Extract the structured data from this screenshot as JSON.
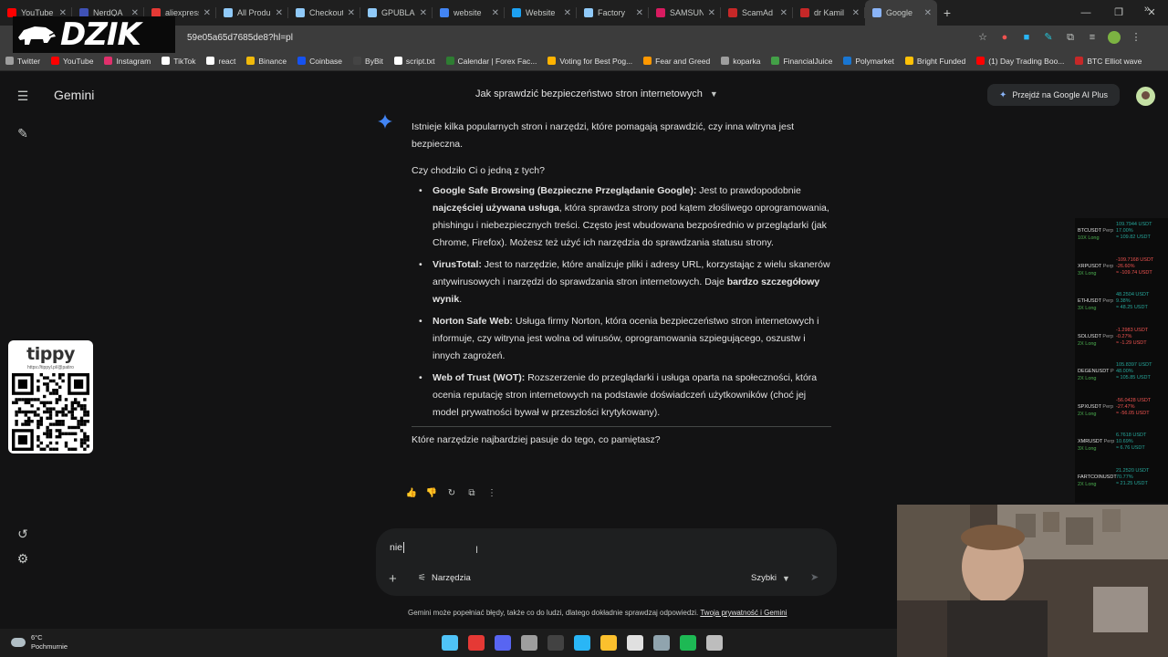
{
  "browser": {
    "tabs": [
      {
        "label": "YouTube",
        "color": "#ff0000",
        "active": false
      },
      {
        "label": "NerdQA",
        "color": "#3f51b5",
        "active": false
      },
      {
        "label": "aliexpress",
        "color": "#e53935",
        "active": false
      },
      {
        "label": "All Produ",
        "color": "#90caf9",
        "active": false
      },
      {
        "label": "Checkout",
        "color": "#90caf9",
        "active": false
      },
      {
        "label": "GPUBLA",
        "color": "#90caf9",
        "active": false
      },
      {
        "label": "website",
        "color": "#4285f4",
        "active": false
      },
      {
        "label": "Website",
        "color": "#1da1f2",
        "active": false
      },
      {
        "label": "Factory",
        "color": "#90caf9",
        "active": false
      },
      {
        "label": "SAMSUN",
        "color": "#d81b60",
        "active": false
      },
      {
        "label": "ScamAd",
        "color": "#c62828",
        "active": false
      },
      {
        "label": "dr Kamil",
        "color": "#c62828",
        "active": false
      },
      {
        "label": "Google",
        "color": "#8ab4f8",
        "active": true
      }
    ],
    "url": "59e05a65d7685de8?hl=pl",
    "bookmarks": [
      {
        "label": "Twitter",
        "color": "#9e9e9e"
      },
      {
        "label": "YouTube",
        "color": "#ff0000"
      },
      {
        "label": "Instagram",
        "color": "#e1306c"
      },
      {
        "label": "TikTok",
        "color": "#ffffff"
      },
      {
        "label": "react",
        "color": "#ffffff"
      },
      {
        "label": "Binance",
        "color": "#f0b90b"
      },
      {
        "label": "Coinbase",
        "color": "#1652f0"
      },
      {
        "label": "ByBit",
        "color": "#444444"
      },
      {
        "label": "script.txt",
        "color": "#ffffff"
      },
      {
        "label": "Calendar | Forex Fac...",
        "color": "#2e7d32"
      },
      {
        "label": "Voting for Best Pog...",
        "color": "#ffb300"
      },
      {
        "label": "Fear and Greed",
        "color": "#ff9800"
      },
      {
        "label": "koparka",
        "color": "#9e9e9e"
      },
      {
        "label": "FinancialJuice",
        "color": "#43a047"
      },
      {
        "label": "Polymarket",
        "color": "#1976d2"
      },
      {
        "label": "Bright Funded",
        "color": "#ffc107"
      },
      {
        "label": "(1) Day Trading Boo...",
        "color": "#ff0000"
      },
      {
        "label": "BTC Elliot wave",
        "color": "#c62828"
      }
    ]
  },
  "overlay": {
    "logo_text": "DZIK",
    "tippy_title": "tippy",
    "tippy_url": "https://tippyl.pl/@patiro"
  },
  "gemini": {
    "app_title": "Gemini",
    "conversation_title": "Jak sprawdzić bezpieczeństwo stron internetowych",
    "upgrade_label": "Przejdź na Google AI Plus",
    "response": {
      "intro": "Istnieje kilka popularnych stron i narzędzi, które pomagają sprawdzić, czy inna witryna jest bezpieczna.",
      "question": "Czy chodziło Ci o jedną z tych?",
      "items": [
        {
          "name": "Google Safe Browsing (Bezpieczne Przeglądanie Google):",
          "t1": " Jest to prawdopodobnie ",
          "b1": "najczęściej używana usługa",
          "t2": ", która sprawdza strony pod kątem złośliwego oprogramowania, phishingu i niebezpiecznych treści. Często jest wbudowana bezpośrednio w przeglądarki (jak Chrome, Firefox). Możesz też użyć ich narzędzia do sprawdzania statusu strony."
        },
        {
          "name": "VirusTotal:",
          "t1": " Jest to narzędzie, które analizuje pliki i adresy URL, korzystając z wielu skanerów antywirusowych i narzędzi do sprawdzania stron internetowych. Daje ",
          "b1": "bardzo szczegółowy wynik",
          "t2": "."
        },
        {
          "name": "Norton Safe Web:",
          "t1": " Usługa firmy Norton, która ocenia bezpieczeństwo stron internetowych i informuje, czy witryna jest wolna od wirusów, oprogramowania szpiegującego, oszustw i innych zagrożeń.",
          "b1": "",
          "t2": ""
        },
        {
          "name": "Web of Trust (WOT):",
          "t1": " Rozszerzenie do przeglądarki i usługa oparta na społeczności, która ocenia reputację stron internetowych na podstawie doświadczeń użytkowników (choć jej model prywatności bywał w przeszłości krytykowany).",
          "b1": "",
          "t2": ""
        }
      ],
      "follow_up": "Które narzędzie najbardziej pasuje do tego, co pamiętasz?"
    },
    "composer": {
      "input_value": "nie",
      "tools_label": "Narzędzia",
      "model_label": "Szybki"
    },
    "disclaimer": "Gemini może popełniać błędy, także co do ludzi, dlatego dokładnie sprawdzaj odpowiedzi.",
    "privacy_link": "Twoja prywatność i Gemini"
  },
  "ticker": [
    {
      "symbol": "BTCUSDT",
      "type": "Perp",
      "leverage": "10X Long",
      "price": "109.7944 USDT",
      "pct": "17.00%",
      "entry": "≈ 109.82 USDT",
      "dir": "up"
    },
    {
      "symbol": "XRPUSDT",
      "type": "Perp",
      "leverage": "3X Long",
      "price": "-109.7168 USDT",
      "pct": "-26.60%",
      "entry": "≈ -109.74 USDT",
      "dir": "down"
    },
    {
      "symbol": "ETHUSDT",
      "type": "Perp",
      "leverage": "3X Long",
      "price": "48.2504 USDT",
      "pct": "9.38%",
      "entry": "≈ 48.25 USDT",
      "dir": "up"
    },
    {
      "symbol": "SOLUSDT",
      "type": "Perp",
      "leverage": "2X Long",
      "price": "-1.2983 USDT",
      "pct": "-0.27%",
      "entry": "≈ -1.29 USDT",
      "dir": "down"
    },
    {
      "symbol": "DEGENUSDT",
      "type": "P",
      "leverage": "2X Long",
      "price": "105.8397 USDT",
      "pct": "48.00%",
      "entry": "≈ 105.85 USDT",
      "dir": "up"
    },
    {
      "symbol": "SPXUSDT",
      "type": "Perp",
      "leverage": "2X Long",
      "price": "-56.0428 USDT",
      "pct": "-27.47%",
      "entry": "≈ -56.05 USDT",
      "dir": "down"
    },
    {
      "symbol": "XMRUSDT",
      "type": "Perp",
      "leverage": "3X Long",
      "price": "6.7618 USDT",
      "pct": "10.69%",
      "entry": "≈ 6.76 USDT",
      "dir": "up"
    },
    {
      "symbol": "FARTCOINUSDT",
      "type": "",
      "leverage": "2X Long",
      "price": "21.2520 USDT",
      "pct": "70.77%",
      "entry": "≈ 21.25 USDT",
      "dir": "up"
    }
  ],
  "taskbar": {
    "temperature": "6°C",
    "condition": "Pochmurnie",
    "apps": [
      {
        "name": "windows",
        "color": "#4fc3f7"
      },
      {
        "name": "chrome",
        "color": "#e53935"
      },
      {
        "name": "discord",
        "color": "#5865f2"
      },
      {
        "name": "app",
        "color": "#9e9e9e"
      },
      {
        "name": "obs",
        "color": "#424242"
      },
      {
        "name": "telegram",
        "color": "#29b6f6"
      },
      {
        "name": "explorer",
        "color": "#fbc02d"
      },
      {
        "name": "ccleaner",
        "color": "#e0e0e0"
      },
      {
        "name": "tool",
        "color": "#90a4ae"
      },
      {
        "name": "spotify",
        "color": "#1db954"
      },
      {
        "name": "app2",
        "color": "#bdbdbd"
      }
    ]
  }
}
